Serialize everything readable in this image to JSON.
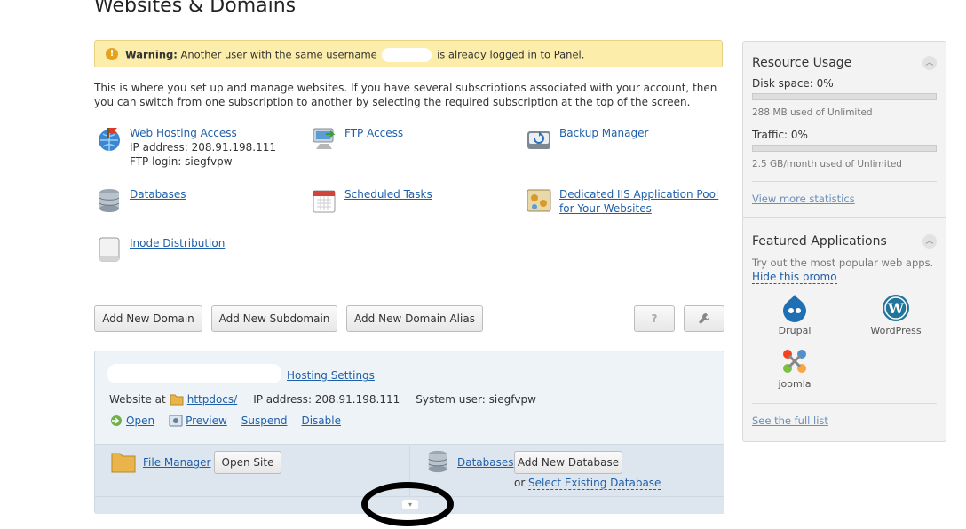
{
  "page_title": "Websites & Domains",
  "warning": {
    "label": "Warning:",
    "text_before": "Another user with the same username",
    "text_after": "is already logged in to Panel."
  },
  "intro": "This is where you set up and manage websites. If you have several subscriptions associated with your account, then you can switch from one subscription to another by selecting the required subscription at the top of the screen.",
  "tools": {
    "web_hosting": {
      "label": "Web Hosting Access",
      "ip": "IP address: 208.91.198.111",
      "ftp_login": "FTP login: siegfvpw"
    },
    "ftp_access": {
      "label": "FTP Access"
    },
    "backup_manager": {
      "label": "Backup Manager"
    },
    "databases": {
      "label": "Databases"
    },
    "scheduled_tasks": {
      "label": "Scheduled Tasks"
    },
    "iis_pool": {
      "label_line1": "Dedicated IIS Application Pool",
      "label_line2": "for Your Websites"
    },
    "inode": {
      "label": "Inode Distribution"
    }
  },
  "actions": {
    "add_domain": "Add New Domain",
    "add_subdomain": "Add New Subdomain",
    "add_alias": "Add New Domain Alias",
    "help": "?",
    "tools_icon": "wrench-icon"
  },
  "domain": {
    "hosting_settings": "Hosting Settings",
    "website_at": "Website at",
    "folder": "httpdocs/",
    "ip": "IP address: 208.91.198.111",
    "system_user": "System user: siegfvpw",
    "open": "Open",
    "preview": "Preview",
    "suspend": "Suspend",
    "disable": "Disable",
    "file_manager": "File Manager",
    "open_site": "Open Site",
    "databases": "Databases",
    "add_database": "Add New Database",
    "or": "or",
    "select_db": "Select Existing Database"
  },
  "resource_usage": {
    "title": "Resource Usage",
    "disk_label": "Disk space: 0%",
    "disk_percent": 0,
    "disk_detail": "288 MB used of Unlimited",
    "traffic_label": "Traffic: 0%",
    "traffic_percent": 0,
    "traffic_detail": "2.5 GB/month used of Unlimited",
    "more_stats": "View more statistics"
  },
  "featured": {
    "title": "Featured Applications",
    "desc": "Try out the most popular web apps.",
    "hide": "Hide this promo",
    "apps": [
      "Drupal",
      "WordPress",
      "joomla"
    ],
    "full_list": "See the full list"
  },
  "colors": {
    "link": "#1f5fa8",
    "warning_bg": "#fcedab",
    "panel_bg": "#eef3f8"
  }
}
